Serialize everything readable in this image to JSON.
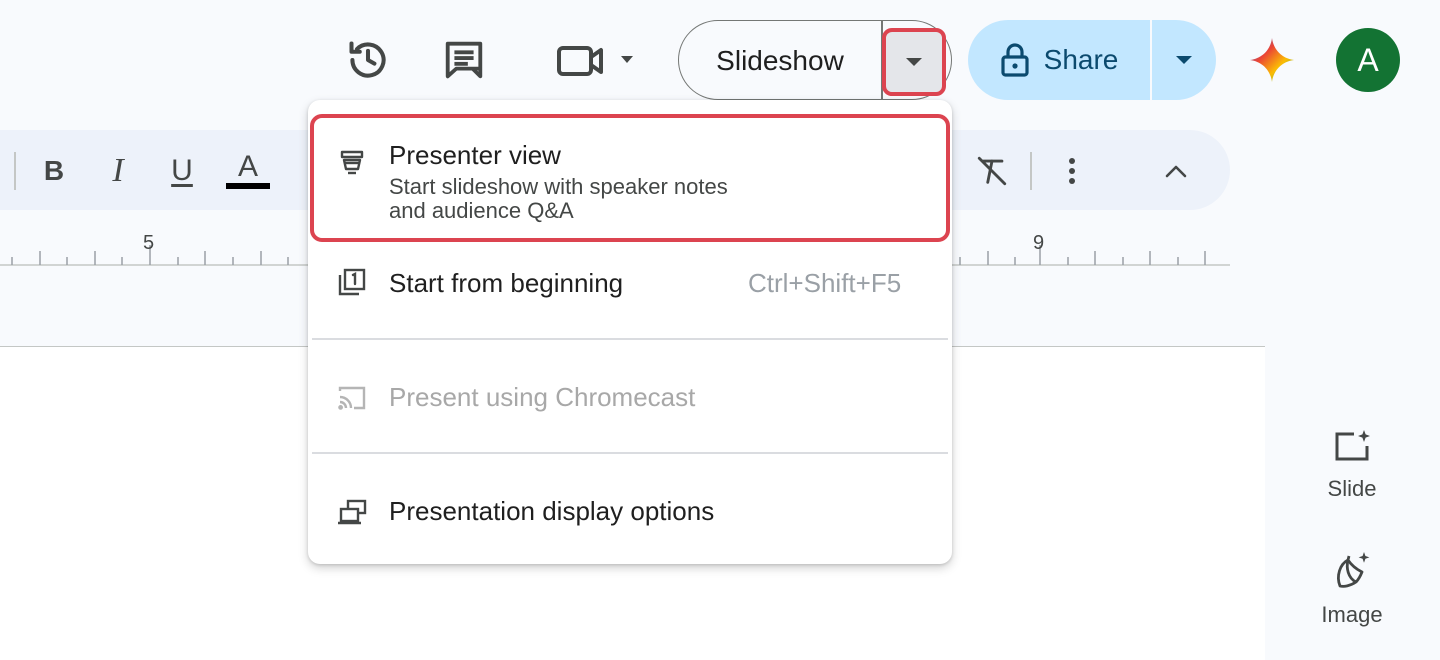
{
  "header": {
    "slideshow_label": "Slideshow",
    "share_label": "Share",
    "avatar_initial": "A",
    "icons": [
      "version-history-icon",
      "comments-icon",
      "meet-icon",
      "gemini-icon"
    ]
  },
  "toolbar": {
    "bold_label": "B",
    "italic_label": "I",
    "underline_label": "U",
    "text_color_label": "A",
    "icons": [
      "bold-icon",
      "italic-icon",
      "underline-icon",
      "text-color-icon",
      "clear-formatting-icon",
      "more-options-icon",
      "collapse-icon"
    ]
  },
  "ruler": {
    "labels": [
      "5",
      "9"
    ]
  },
  "side_panel": {
    "slide_label": "Slide",
    "image_label": "Image"
  },
  "menu": {
    "items": [
      {
        "title": "Presenter view",
        "subtitle_line1": "Start slideshow with speaker notes",
        "subtitle_line2": "and audience Q&A",
        "icon": "presenter-view-icon"
      },
      {
        "title": "Start from beginning",
        "shortcut": "Ctrl+Shift+F5",
        "icon": "start-from-beginning-icon"
      },
      {
        "title": "Present using Chromecast",
        "icon": "chromecast-icon",
        "disabled": true
      },
      {
        "title": "Presentation display options",
        "icon": "display-options-icon"
      }
    ]
  },
  "colors": {
    "accent_highlight": "#dc4450",
    "share_bg": "#c2e7ff",
    "avatar_bg": "#137333"
  }
}
